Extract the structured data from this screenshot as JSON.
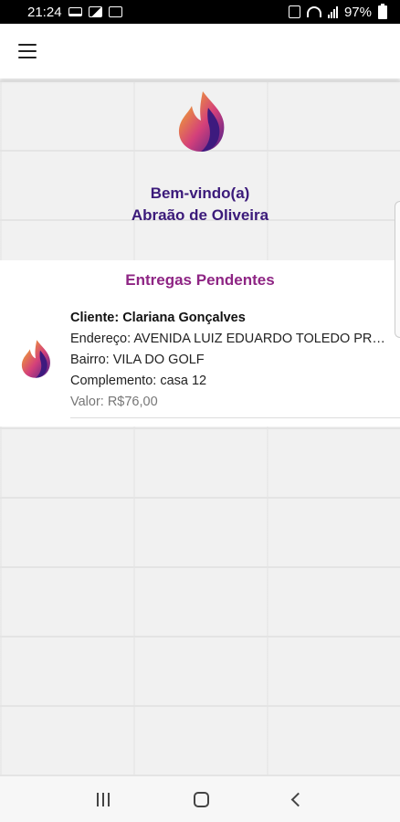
{
  "status_bar": {
    "time": "21:24",
    "battery": "97%"
  },
  "app_bar": {
    "menu_icon": "menu-icon"
  },
  "welcome": {
    "greeting": "Bem-vindo(a)",
    "user_name": "Abraão de Oliveira"
  },
  "pending": {
    "title": "Entregas Pendentes",
    "items": [
      {
        "client": "Cliente: Clariana Gonçalves",
        "address": "Endereço: AVENIDA LUIZ EDUARDO TOLEDO PRADO",
        "neighborhood": "Bairro: VILA DO GOLF",
        "complement": "Complemento: casa 12",
        "value": "Valor: R$76,00"
      }
    ]
  },
  "colors": {
    "primary_purple": "#3b1a7a",
    "accent_magenta": "#8e2584",
    "flame_yellow": "#f5b417"
  }
}
